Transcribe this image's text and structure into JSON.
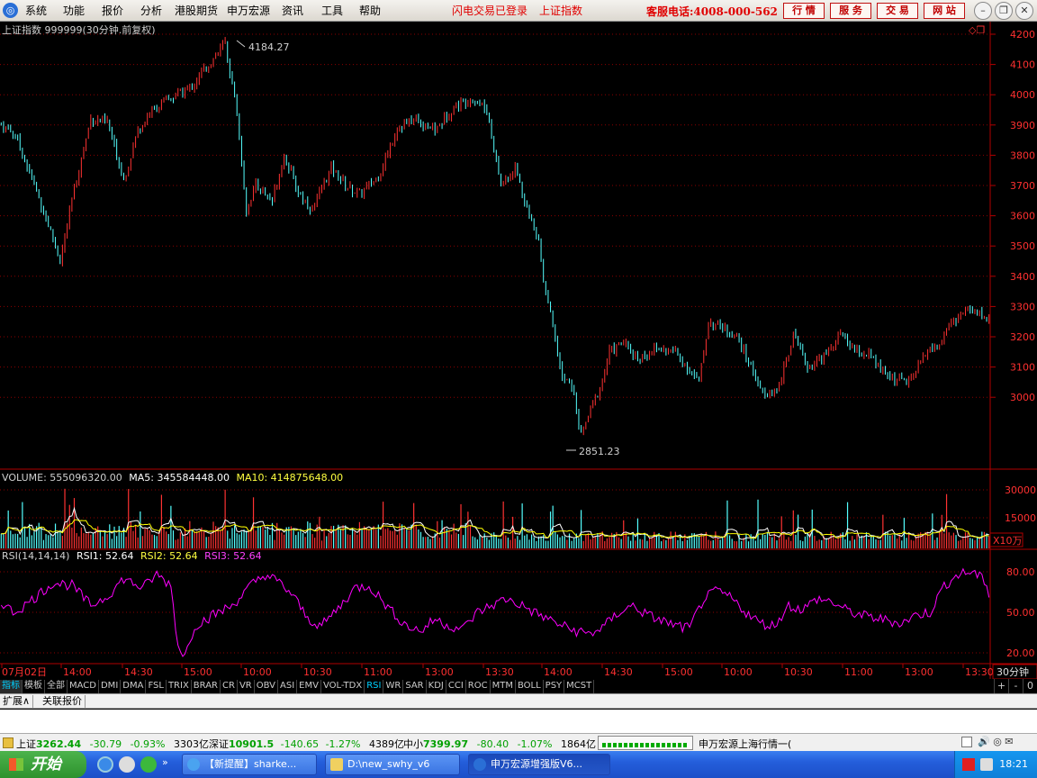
{
  "menu": {
    "items": [
      "系统",
      "功能",
      "报价",
      "分析",
      "港股期货",
      "申万宏源",
      "资讯",
      "工具",
      "帮助"
    ],
    "login_status": "闪电交易已登录",
    "index_name": "上证指数",
    "hotline": "客服电话:4008-000-562",
    "top_buttons": [
      "行 情",
      "服 务",
      "交 易",
      "网 站"
    ]
  },
  "chart": {
    "title": "上证指数 999999(30分钟.前复权)",
    "high_label": "4184.27",
    "low_label": "2851.23",
    "price_ticks": [
      "4200",
      "4100",
      "4000",
      "3900",
      "3800",
      "3700",
      "3600",
      "3500",
      "3400",
      "3300",
      "3200",
      "3100",
      "3000"
    ],
    "volume_header": {
      "volume": "VOLUME: 555096320.00",
      "ma5": "MA5: 345584448.00",
      "ma10": "MA10: 414875648.00"
    },
    "volume_ticks": [
      "30000",
      "15000"
    ],
    "volume_unit": "X10万",
    "rsi_header": {
      "name": "RSI(14,14,14)",
      "rsi1": "RSI1: 52.64",
      "rsi2": "RSI2: 52.64",
      "rsi3": "RSI3: 52.64"
    },
    "rsi_ticks": [
      "80.00",
      "50.00",
      "20.00"
    ],
    "time_labels": [
      "07月02日",
      "14:00",
      "14:30",
      "15:00",
      "10:00",
      "10:30",
      "11:00",
      "13:00",
      "13:30",
      "14:00",
      "14:30",
      "15:00",
      "10:00",
      "10:30",
      "11:00",
      "13:00",
      "13:30"
    ],
    "period": "30分钟",
    "colors": {
      "up": "#ff3232",
      "down": "#54ffff",
      "grid": "#8b0000",
      "ma5": "#ffffff",
      "ma10": "#ffff00",
      "rsi": "#ff00ff"
    }
  },
  "indicator_tabs": [
    "指标",
    "模板",
    "全部",
    "MACD",
    "DMI",
    "DMA",
    "FSL",
    "TRIX",
    "BRAR",
    "CR",
    "VR",
    "OBV",
    "ASI",
    "EMV",
    "VOL-TDX",
    "RSI",
    "WR",
    "SAR",
    "KDJ",
    "CCI",
    "ROC",
    "MTM",
    "BOLL",
    "PSY",
    "MCST"
  ],
  "tab_controls": [
    "+",
    "-",
    "0"
  ],
  "ext_tabs": [
    "扩展∧",
    "关联报价"
  ],
  "status": {
    "sh": {
      "name": "上证",
      "value": "3262.44",
      "change": "-30.79",
      "pct": "-0.93%",
      "amount": "3303亿"
    },
    "sz": {
      "name": "深证",
      "value": "10901.5",
      "change": "-140.65",
      "pct": "-1.27%",
      "amount": "4389亿"
    },
    "sme": {
      "name": "中小",
      "value": "7399.97",
      "change": "-80.40",
      "pct": "-1.07%",
      "amount": "1864亿"
    },
    "server": "申万宏源上海行情一("
  },
  "taskbar": {
    "start": "开始",
    "tasks": [
      "【新提醒】sharke...",
      "D:\\new_swhy_v6",
      "申万宏源增强版V6..."
    ],
    "clock": "18:21"
  }
}
